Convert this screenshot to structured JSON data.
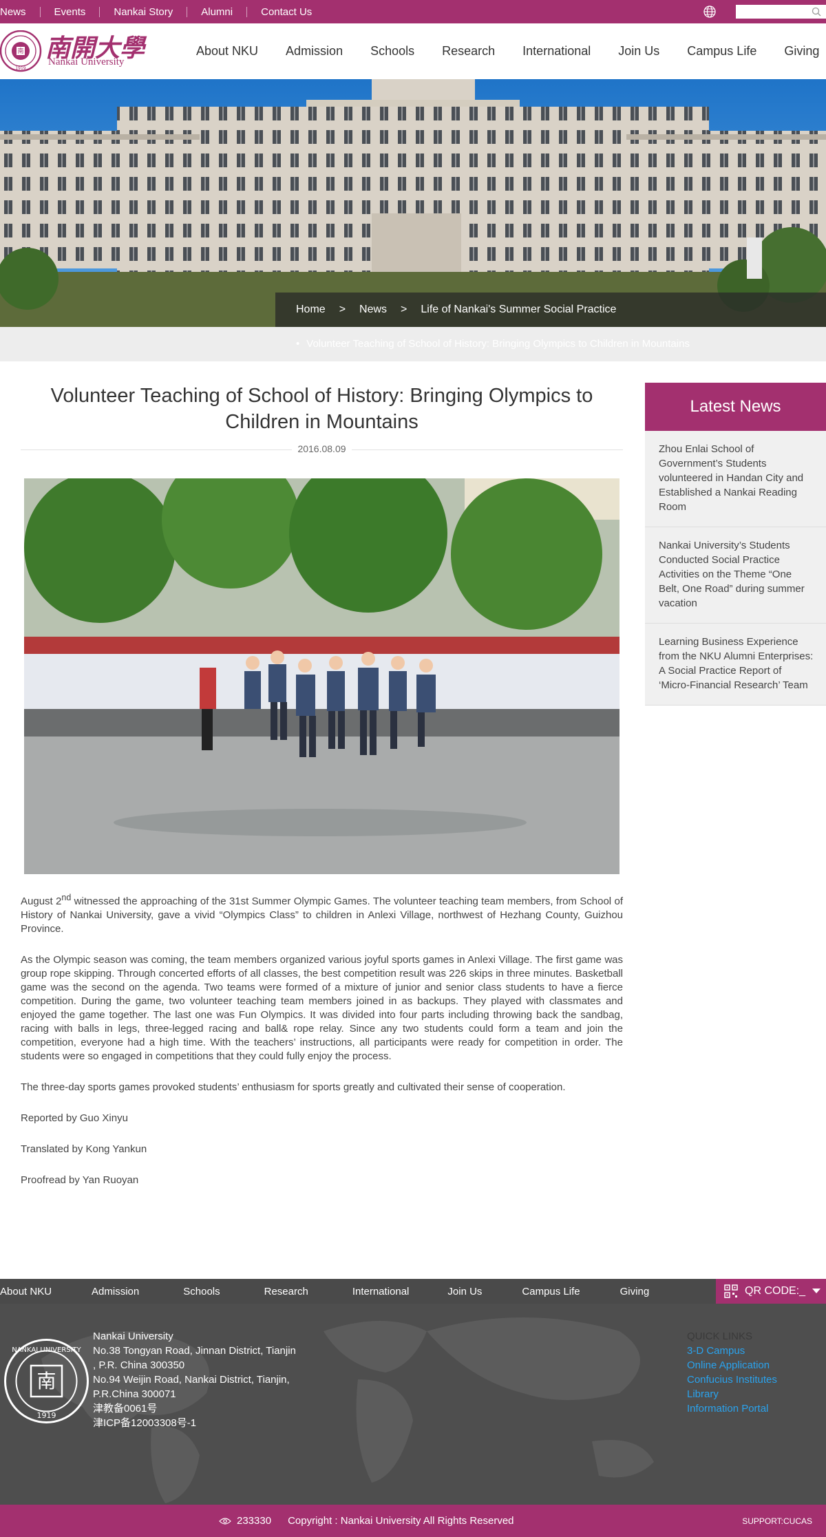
{
  "topbar": {
    "links": [
      "News",
      "Events",
      "Nankai Story",
      "Alumni",
      "Contact Us"
    ],
    "search_placeholder": ""
  },
  "header": {
    "logo_chinese": "南開大學",
    "logo_english": "Nankai University",
    "nav": [
      "About NKU",
      "Admission",
      "Schools",
      "Research",
      "International",
      "Join Us",
      "Campus Life",
      "Giving"
    ]
  },
  "breadcrumb": {
    "home": "Home",
    "sep1": ">",
    "news": "News",
    "sep2": ">",
    "section": "Life of Nankai's Summer Social Practice",
    "current": "Volunteer Teaching of School of History: Bringing Olympics to Children in Mountains"
  },
  "article": {
    "title": "Volunteer Teaching of School of History: Bringing Olympics to Children in Mountains",
    "date": "2016.08.09",
    "p1_pre": "August 2",
    "p1_sup": "nd",
    "p1_post": " witnessed the approaching of the 31st Summer Olympic Games. The volunteer teaching team members, from School of History of Nankai University, gave a vivid “Olympics Class” to children in Anlexi Village, northwest of Hezhang County, Guizhou Province.",
    "p2": "As the Olympic season was coming, the team members organized various joyful sports games in Anlexi Village. The first game was group rope skipping. Through concerted efforts of all classes, the best competition result was 226 skips in three minutes. Basketball game was the second on the agenda. Two teams were formed of a mixture of junior and senior class students to have a fierce competition. During the game, two volunteer teaching team members joined in as backups. They played with classmates and enjoyed the game together. The last one was Fun Olympics. It was divided into four parts including throwing back the sandbag, racing with balls in legs, three-legged racing and ball& rope relay. Since any two students could form a team and join the competition, everyone had a high time. With the teachers’ instructions, all participants were ready for competition in order. The students were so engaged in competitions that they could fully enjoy the process.",
    "p3": "The three-day sports games provoked students’ enthusiasm for sports greatly and cultivated their sense of cooperation.",
    "reported": "Reported by Guo Xinyu",
    "translated": "Translated by Kong Yankun",
    "proofread": "Proofread by Yan Ruoyan"
  },
  "sidebar": {
    "heading": "Latest News",
    "items": [
      "Zhou Enlai School of Government’s Students volunteered in Handan City and Established a Nankai Reading Room",
      "Nankai University’s Students Conducted Social Practice Activities on the Theme “One Belt, One Road” during summer vacation",
      "Learning Business Experience from the NKU Alumni Enterprises: A Social Practice Report of ‘Micro-Financial Research’ Team"
    ]
  },
  "footer": {
    "nav": [
      "About NKU",
      "Admission",
      "Schools",
      "Research",
      "International",
      "Join Us",
      "Campus Life",
      "Giving"
    ],
    "qr_label": "QR CODE:_",
    "address_lines": [
      "Nankai University",
      "No.38 Tongyan Road, Jinnan District, Tianjin",
      ", P.R. China 300350",
      "No.94 Weijin Road,  Nankai District, Tianjin,",
      "P.R.China  300071",
      "津教备0061号",
      "津ICP备12003308号-1"
    ],
    "quick_heading": "QUICK LINKS",
    "quick_links": [
      "3-D Campus",
      "Online Application",
      "Confucius Institutes",
      "Library",
      "Information Portal"
    ],
    "visit_count": "233330",
    "copyright": "Copyright : Nankai University All Rights Reserved",
    "support": "SUPPORT:CUCAS"
  },
  "colors": {
    "brand": "#a3306f",
    "link": "#2aa3ee",
    "footer_bg": "#4e4e4e"
  }
}
